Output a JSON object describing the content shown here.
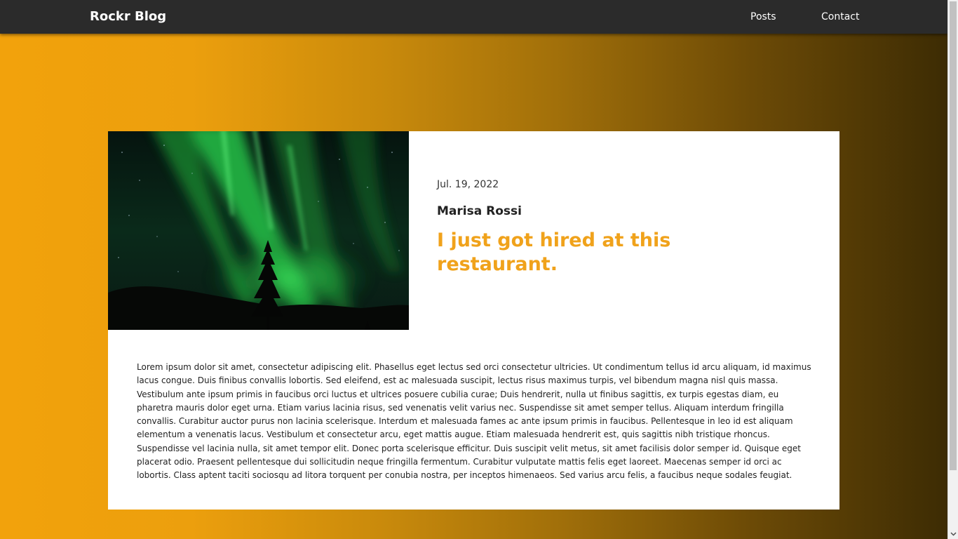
{
  "navbar": {
    "brand": "Rockr Blog",
    "links": [
      "Posts",
      "Contact"
    ],
    "background": "#2b2b2b"
  },
  "theme": {
    "accent": "#f0a21b",
    "gradient_start": "#f2a20c",
    "gradient_end": "#3a2a04"
  },
  "post": {
    "image_description_icon": "aurora-photo",
    "date": "Jul. 19, 2022",
    "author": "Marisa Rossi",
    "title": "I just got hired at this restaurant.",
    "body": "Lorem ipsum dolor sit amet, consectetur adipiscing elit. Phasellus eget lectus sed orci consectetur ultricies. Ut condimentum tellus id arcu aliquam, id maximus lacus congue. Duis finibus convallis lobortis. Sed eleifend, est ac malesuada suscipit, lectus risus maximus turpis, vel bibendum magna nisl quis massa. Vestibulum ante ipsum primis in faucibus orci luctus et ultrices posuere cubilia curae; Duis hendrerit, nulla ut finibus sagittis, ex turpis egestas diam, eu pharetra mauris dolor eget urna. Etiam varius lacinia risus, sed venenatis velit varius nec. Suspendisse sit amet semper tellus. Aliquam interdum fringilla convallis. Curabitur auctor purus non lacinia scelerisque. Interdum et malesuada fames ac ante ipsum primis in faucibus. Pellentesque in leo id est aliquam elementum a venenatis lacus. Vestibulum et consectetur arcu, eget mattis augue. Etiam malesuada hendrerit est, quis sagittis nibh tristique rhoncus. Suspendisse vel lacinia nulla, sit amet tempor elit. Donec porta scelerisque efficitur. Duis suscipit velit metus, sit amet facilisis dolor semper id. Quisque eget placerat odio. Praesent pellentesque dui sollicitudin neque fringilla fermentum. Curabitur vulputate mattis felis eget laoreet. Maecenas semper id orci ac lobortis. Class aptent taciti sociosqu ad litora torquent per conubia nostra, per inceptos himenaeos. Sed varius arcu felis, a faucibus neque sodales feugiat."
  },
  "scrollbar": {
    "arrow_icon": "chevron-down-icon"
  }
}
